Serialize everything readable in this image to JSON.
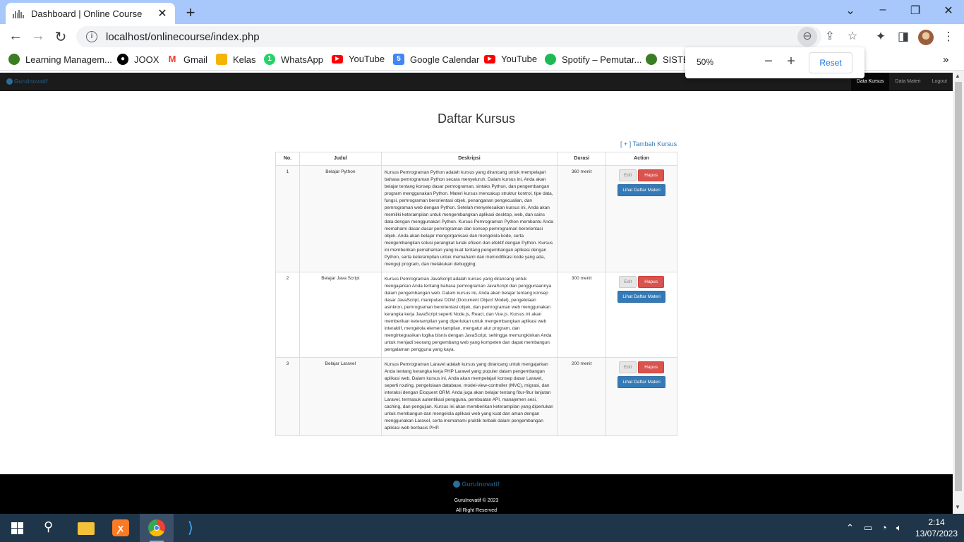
{
  "browser": {
    "tab_title": "Dashboard | Online Course",
    "url": "localhost/onlinecourse/index.php",
    "bookmarks": [
      {
        "label": "Learning Managem...",
        "icon": "lms-icon",
        "color": "#3b7d23"
      },
      {
        "label": "JOOX",
        "icon": "joox-icon",
        "color": "#000000"
      },
      {
        "label": "Gmail",
        "icon": "gmail-icon",
        "color": "#ea4335"
      },
      {
        "label": "Kelas",
        "icon": "classroom-icon",
        "color": "#f4b400"
      },
      {
        "label": "WhatsApp",
        "icon": "whatsapp-icon",
        "color": "#25d366"
      },
      {
        "label": "YouTube",
        "icon": "youtube-icon",
        "color": "#ff0000"
      },
      {
        "label": "Google Calendar",
        "icon": "calendar-icon",
        "color": "#4285f4"
      },
      {
        "label": "YouTube",
        "icon": "youtube-icon",
        "color": "#ff0000"
      },
      {
        "label": "Spotify – Pemutar...",
        "icon": "spotify-icon",
        "color": "#1db954"
      },
      {
        "label": "SISTEM",
        "icon": "sistem-icon",
        "color": "#3b7d23"
      }
    ],
    "zoom": {
      "value": "50%",
      "reset_label": "Reset"
    }
  },
  "site": {
    "brand": "GuruInovatif",
    "nav": [
      {
        "label": "Data Kursus",
        "active": true
      },
      {
        "label": "Data Materi",
        "active": false
      },
      {
        "label": "Logout",
        "active": false
      }
    ],
    "page_title": "Daftar Kursus",
    "add_link": "[ + ] Tambah Kursus",
    "table": {
      "headers": [
        "No.",
        "Judul",
        "Deskripsi",
        "Durasi",
        "Action"
      ],
      "rows": [
        {
          "no": "1",
          "judul": "Belajar Python",
          "deskripsi": "Kursus Pemrograman Python adalah kursus yang dirancang untuk mempelajari bahasa pemrograman Python secara menyeluruh. Dalam kursus ini, Anda akan belajar tentang konsep dasar pemrograman, sintaks Python, dan pengembangan program menggunakan Python. Materi kursus mencakup struktur kontrol, tipe data, fungsi, pemrograman berorientasi objek, penanganan pengecualian, dan pemrograman web dengan Python. Setelah menyelesaikan kursus ini, Anda akan memiliki keterampilan untuk mengembangkan aplikasi desktop, web, dan sains data dengan menggunakan Python. Kursus Pemrograman Python membantu Anda memahami dasar-dasar pemrograman dan konsep pemrograman berorientasi objek. Anda akan belajar mengorganisasi dan mengelola kode, serta mengembangkan solusi perangkat lunak efisien dan efektif dengan Python. Kursus ini memberikan pemahaman yang kuat tentang pengembangan aplikasi dengan Python, serta keterampilan untuk memahami dan memodifikasi kode yang ada, menguji program, dan melakukan debugging.",
          "durasi": "360 menit"
        },
        {
          "no": "2",
          "judul": "Belajar Java Script",
          "deskripsi": "Kursus Pemrograman JavaScript adalah kursus yang dirancang untuk mengajarkan Anda tentang bahasa pemrograman JavaScript dan penggunaannya dalam pengembangan web. Dalam kursus ini, Anda akan belajar tentang konsep dasar JavaScript, manipulasi DOM (Document Object Model), pengelolaan asinkron, pemrograman berorientasi objek, dan pemrograman web menggunakan kerangka kerja JavaScript seperti Node.js, React, dan Vue.js. Kursus ini akan memberikan keterampilan yang diperlukan untuk mengembangkan aplikasi web interaktif, mengelola elemen tampilan, mengatur alur program, dan mengintegrasikan logika bisnis dengan JavaScript, sehingga memungkinkan Anda untuk menjadi seorang pengembang web yang kompeten dan dapat membangun pengalaman pengguna yang kaya.",
          "durasi": "300 menit"
        },
        {
          "no": "3",
          "judul": "Belajar Laravel",
          "deskripsi": "Kursus Pemrograman Laravel adalah kursus yang dirancang untuk mengajarkan Anda tentang kerangka kerja PHP Laravel yang populer dalam pengembangan aplikasi web. Dalam kursus ini, Anda akan mempelajari konsep dasar Laravel, seperti routing, pengelolaan database, model-view-controller (MVC), migrasi, dan interaksi dengan Eloquent ORM. Anda juga akan belajar tentang fitur-fitur lanjutan Laravel, termasuk autentikasi pengguna, pembuatan API, manajemen sesi, caching, dan pengujian. Kursus ini akan memberikan keterampilan yang diperlukan untuk membangun dan mengelola aplikasi web yang kuat dan aman dengan menggunakan Laravel, serta memahami praktik terbaik dalam pengembangan aplikasi web berbasis PHP.",
          "durasi": "200 menit"
        }
      ],
      "buttons": {
        "edit": "Edit",
        "hapus": "Hapus",
        "lihat": "Lihat Daftar Materi"
      }
    },
    "footer": {
      "brand": "GuruInovatif",
      "copyright": "GuruInovatif © 2023",
      "rights": "All Right Reserved"
    }
  },
  "taskbar": {
    "apps": [
      "windows-start-icon",
      "search-icon",
      "file-explorer-icon",
      "xampp-icon",
      "chrome-icon",
      "vscode-icon"
    ],
    "time": "2:14",
    "date": "13/07/2023"
  }
}
